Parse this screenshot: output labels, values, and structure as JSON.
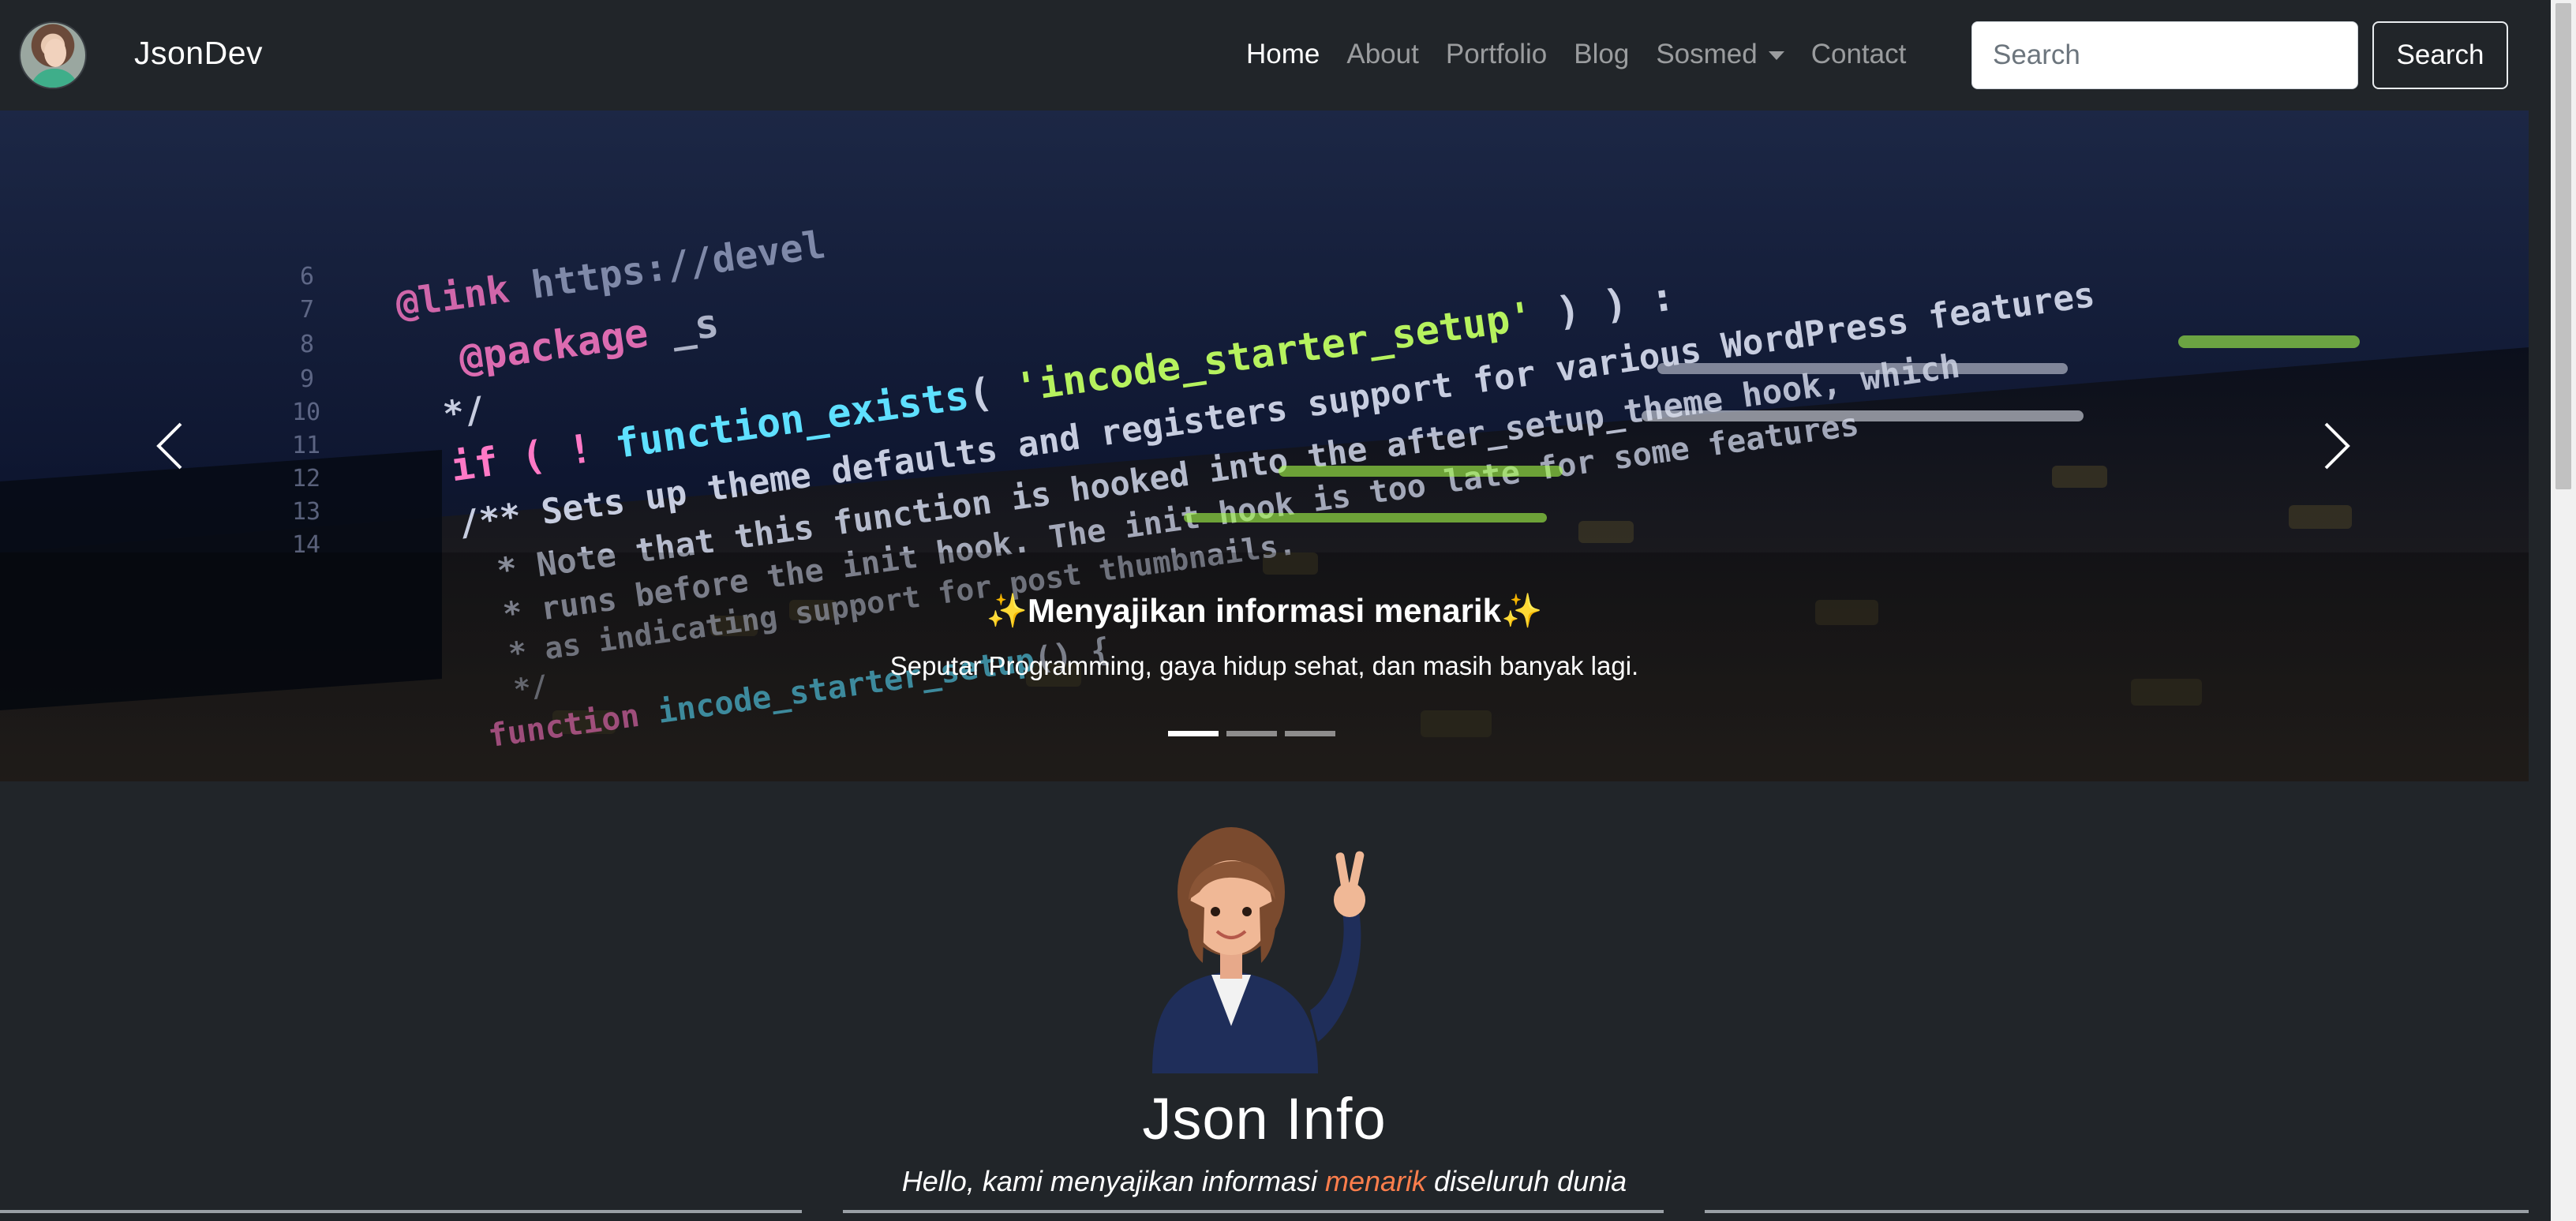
{
  "navbar": {
    "brand": "JsonDev",
    "links": [
      {
        "label": "Home",
        "active": true
      },
      {
        "label": "About",
        "active": false
      },
      {
        "label": "Portfolio",
        "active": false
      },
      {
        "label": "Blog",
        "active": false
      },
      {
        "label": "Sosmed",
        "active": false,
        "dropdown": true
      },
      {
        "label": "Contact",
        "active": false
      }
    ],
    "search_placeholder": "Search",
    "search_button": "Search"
  },
  "carousel": {
    "caption_title": "✨Menyajikan informasi menarik✨",
    "caption_text": "Seputar Programming, gaya hidup sehat, dan masih banyak lagi.",
    "slides": 3,
    "active_slide": 1,
    "code_lines": [
      "@link https://devel",
      "@package _s",
      "*/",
      "if ( ! function_exists( 'incode_starter_setup' ) ) :",
      "/** Sets up theme defaults and registers support for various WordPress features.",
      " * Note that this function is hooked into the after_setup_theme hook, which",
      " * runs before the init hook. The init hook is too late for some features, such",
      " * as indicating support for post thumbnails.",
      " */",
      "function incode_starter_setup() {"
    ]
  },
  "info": {
    "title": "Json Info",
    "lead_before": "Hello, kami menyajikan informasi ",
    "lead_accent": "menarik",
    "lead_after": " diseluruh dunia"
  },
  "colors": {
    "background": "#212529",
    "accent": "#fd7e4c",
    "nav_inactive": "rgba(255,255,255,0.55)"
  }
}
